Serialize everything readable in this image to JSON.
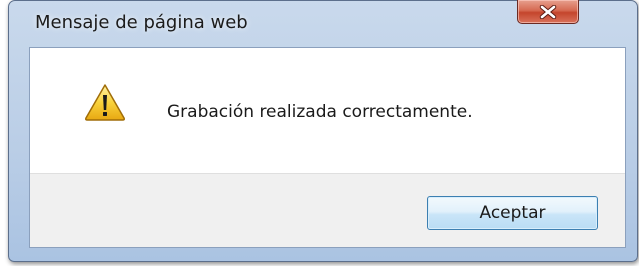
{
  "dialog": {
    "title": "Mensaje de página web",
    "message": "Grabación realizada correctamente.",
    "accept_label": "Aceptar",
    "icon": "warning-icon",
    "close_icon": "close-icon"
  },
  "colors": {
    "frame": "#b9cde6",
    "close_button": "#c4452c",
    "footer": "#f0f0f0",
    "button_border": "#3c7fb1"
  }
}
